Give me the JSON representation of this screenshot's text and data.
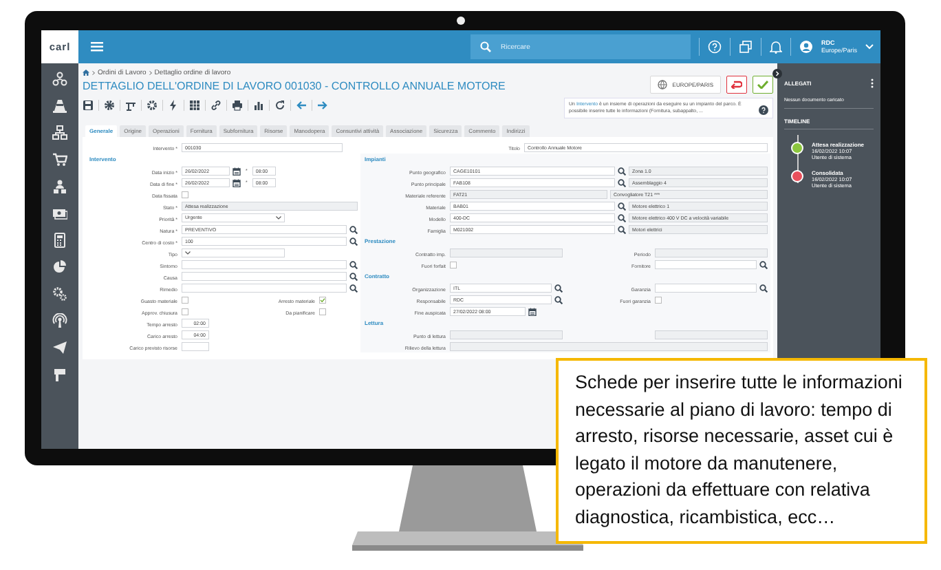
{
  "topbar": {
    "logo": "carl",
    "search_placeholder": "Ricercare",
    "user": "RDC",
    "timezone": "Europe/Paris"
  },
  "breadcrumb": [
    "Ordini di Lavoro",
    "Dettaglio ordine di lavoro"
  ],
  "title": "DETTAGLIO DELL'ORDINE DI LAVORO 001030 - CONTROLLO ANNUALE MOTORE",
  "timezone_button": "EUROPE/PARIS",
  "info": {
    "before": "Un ",
    "link": "Intervento",
    "after": " è un insieme di operazioni da eseguire su un impianto del parco. È possibile inserire tutte le informazioni (Fornitura, subappalto, ..."
  },
  "tabs": [
    {
      "label": "Generale",
      "selected": true
    },
    {
      "label": "Origine",
      "selected": false
    },
    {
      "label": "Operazioni",
      "selected": false
    },
    {
      "label": "Fornitura",
      "selected": false
    },
    {
      "label": "Subfornitura",
      "selected": false
    },
    {
      "label": "Risorse",
      "selected": false
    },
    {
      "label": "Manodopera",
      "selected": false
    },
    {
      "label": "Consuntivi attività",
      "selected": false
    },
    {
      "label": "Associazione",
      "selected": false
    },
    {
      "label": "Sicurezza",
      "selected": false
    },
    {
      "label": "Commento",
      "selected": false
    },
    {
      "label": "Indirizzi",
      "selected": false
    }
  ],
  "form": {
    "top": [
      {
        "label": "Intervento *",
        "kind": "text",
        "value": "001030",
        "readonly": false
      },
      {
        "label": "Titolo",
        "kind": "text",
        "value": "Controllo Annuale Motore",
        "readonly": false
      }
    ],
    "left": [
      {
        "title": "Intervento",
        "rows": [
          {
            "cells": [
              {
                "label": "Data inizio *",
                "kind": "date",
                "value": "26/02/2022",
                "time_label": "*",
                "time": "08:00"
              }
            ]
          },
          {
            "cells": [
              {
                "label": "Data di fine *",
                "kind": "date",
                "value": "26/02/2022",
                "time_label": "*",
                "time": "08:00"
              }
            ]
          },
          {
            "cells": [
              {
                "label": "Data fissata",
                "kind": "checkbox",
                "checked": false
              }
            ]
          },
          {
            "cells": [
              {
                "label": "Stato *",
                "kind": "text",
                "value": "Attesa realizzazione",
                "readonly": true
              }
            ]
          },
          {
            "cells": [
              {
                "label": "Priorità *",
                "kind": "select",
                "value": "Urgente"
              }
            ]
          },
          {
            "cells": [
              {
                "label": "Natura *",
                "kind": "lookup",
                "value": "PREVENTIVO"
              }
            ]
          },
          {
            "cells": [
              {
                "label": "Centro di costo *",
                "kind": "lookup",
                "value": "100"
              }
            ]
          },
          {
            "cells": [
              {
                "label": "Tipo",
                "kind": "select"
              }
            ]
          },
          {
            "cells": [
              {
                "label": "Sintomo",
                "kind": "lookup"
              }
            ]
          },
          {
            "cells": [
              {
                "label": "Causa",
                "kind": "lookup"
              }
            ]
          },
          {
            "cells": [
              {
                "label": "Rimedio",
                "kind": "lookup"
              }
            ]
          },
          {
            "cells": [
              {
                "label": "Guasto materiale",
                "kind": "checkbox",
                "checked": false
              },
              {
                "label": "Arresto materiale",
                "kind": "checkbox",
                "checked": true
              }
            ]
          },
          {
            "cells": [
              {
                "label": "Approv. chiusura",
                "kind": "checkbox",
                "checked": false
              },
              {
                "label": "Da pianificare",
                "kind": "checkbox",
                "checked": false
              }
            ]
          },
          {
            "cells": [
              {
                "label": "Tempo arresto",
                "kind": "duration",
                "value": "02:00"
              }
            ]
          },
          {
            "cells": [
              {
                "label": "Carico arresto",
                "kind": "duration",
                "value": "04:00"
              }
            ]
          },
          {
            "cells": [
              {
                "label": "Carico previsto risorse",
                "kind": "duration"
              }
            ]
          }
        ]
      }
    ],
    "right": [
      {
        "title": "Impianti",
        "rows": [
          {
            "cells": [
              {
                "label": "Punto geografico",
                "kind": "lookup",
                "value": "CAGE10101",
                "side": "Zona 1.0"
              }
            ]
          },
          {
            "cells": [
              {
                "label": "Punto principale",
                "kind": "lookup",
                "value": "FAB108",
                "side": "Assemblaggio 4"
              }
            ]
          },
          {
            "cells": [
              {
                "label": "Materiale referente",
                "kind": "text",
                "value": "FAT21",
                "readonly": true,
                "side": "Convogliatore T21 ***"
              }
            ]
          },
          {
            "cells": [
              {
                "label": "Materiale",
                "kind": "lookup",
                "value": "BAB01",
                "side": "Motore elettrico 1"
              }
            ]
          },
          {
            "cells": [
              {
                "label": "Modello",
                "kind": "lookup",
                "value": "400-DC",
                "side": "Motore elettrico 400 V DC a velocità variabile"
              }
            ]
          },
          {
            "cells": [
              {
                "label": "Famiglia",
                "kind": "lookup",
                "value": "M021002",
                "side": "Motori elettrici"
              }
            ]
          }
        ]
      },
      {
        "title": "Prestazione",
        "rows": [
          {
            "cells": [
              {
                "label": "Contratto imp.",
                "kind": "text",
                "readonly": true
              },
              {
                "label": "Periodo",
                "kind": "text",
                "readonly": true
              }
            ]
          },
          {
            "cells": [
              {
                "label": "Fuori forfait",
                "kind": "checkbox",
                "checked": false
              },
              {
                "label": "Fornitore",
                "kind": "lookup"
              }
            ]
          }
        ]
      },
      {
        "title": "Contratto",
        "rows": [
          {
            "cells": [
              {
                "label": "Organizzazione",
                "kind": "lookup",
                "value": "ITL"
              },
              {
                "label": "Garanzia",
                "kind": "lookup"
              }
            ]
          },
          {
            "cells": [
              {
                "label": "Responsabile",
                "kind": "lookup",
                "value": "RDC"
              },
              {
                "label": "Fuori garanzia",
                "kind": "checkbox",
                "checked": false
              }
            ]
          },
          {
            "cells": [
              {
                "label": "Fine auspicata",
                "kind": "date",
                "value": "27/02/2022 08:00"
              }
            ]
          }
        ]
      },
      {
        "title": "Lettura",
        "rows": [
          {
            "cells": [
              {
                "label": "Punto di lettura",
                "kind": "text",
                "readonly": true
              },
              {
                "kind": "text",
                "readonly": true
              }
            ]
          },
          {
            "cells": [
              {
                "label": "Rilievo della lettura",
                "kind": "text",
                "readonly": true
              }
            ]
          }
        ]
      }
    ]
  },
  "side_panel": {
    "attachments_title": "ALLEGATI",
    "attachments_empty": "Nessun documento caricato",
    "timeline_title": "TIMELINE",
    "timeline": [
      {
        "status": "Attesa realizzazione",
        "date": "16/02/2022 10:07",
        "user": "Utente di sistema",
        "color": "#8cc63e"
      },
      {
        "status": "Consolidata",
        "date": "16/02/2022 10:07",
        "user": "Utente di sistema",
        "color": "#e9505c"
      }
    ]
  },
  "callout": "Schede per inserire tutte le informazioni necessarie al piano di lavoro: tempo di arresto, risorse necessarie, asset cui è legato il motore da manutenere, operazioni da effettuare con relativa diagnostica, ricambistica, ecc…"
}
